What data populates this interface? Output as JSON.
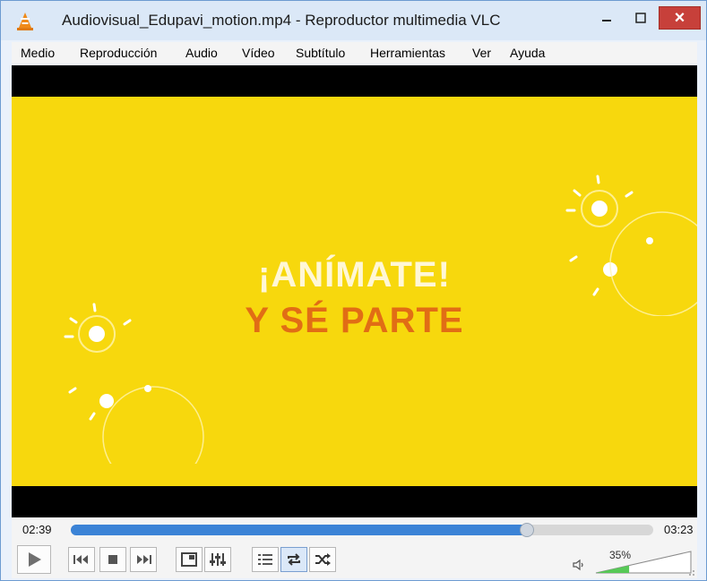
{
  "window": {
    "title": "Audiovisual_Edupavi_motion.mp4 - Reproductor multimedia VLC",
    "close_symbol": "×"
  },
  "menu": [
    {
      "label": "Medio"
    },
    {
      "label": "Reproducción"
    },
    {
      "label": "Audio"
    },
    {
      "label": "Vídeo"
    },
    {
      "label": "Subtítulo"
    },
    {
      "label": "Herramientas"
    },
    {
      "label": "Ver"
    },
    {
      "label": "Ayuda"
    }
  ],
  "video": {
    "line1": "¡ANÍMATE!",
    "line2": "Y SÉ PARTE",
    "background_color": "#f7d80d",
    "line2_color": "#e16d15"
  },
  "playback": {
    "elapsed": "02:39",
    "total": "03:23",
    "progress_fraction": 0.783
  },
  "volume": {
    "label": "35%",
    "level": 0.35
  },
  "icons": {
    "app": "vlc-cone-icon",
    "play": "play-icon",
    "prev": "previous-icon",
    "stop": "stop-icon",
    "next": "next-icon",
    "frame": "fullscreen-icon",
    "eq": "extended-settings-icon",
    "playlist": "playlist-icon",
    "loop": "loop-icon",
    "shuffle": "shuffle-icon",
    "speaker": "speaker-icon"
  }
}
